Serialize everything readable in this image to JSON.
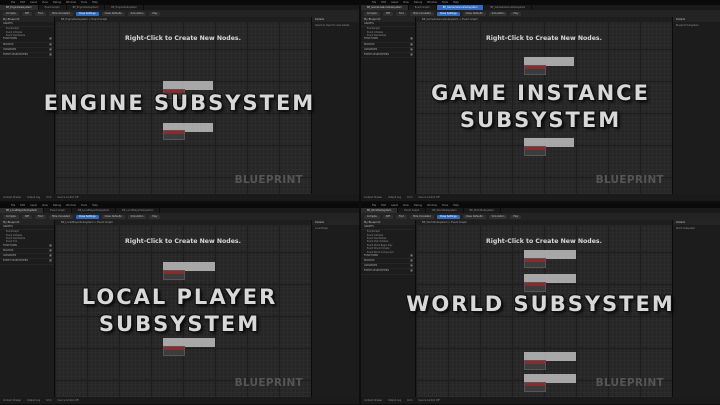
{
  "quadrants": [
    {
      "menu": [
        "File",
        "Edit",
        "Asset",
        "View",
        "Debug",
        "Window",
        "Tools",
        "Help"
      ],
      "tabs": [
        "BP_EngineSubsystem",
        "Event Graph",
        "BP_EngineSubsystem",
        "BP_EngineSubsystem"
      ],
      "toolbar": [
        "Compile",
        "Diff",
        "Find",
        "Hide Unrelated",
        "Class Settings",
        "Class Defaults",
        "Simulation",
        "Play"
      ],
      "left_header": "My Blueprint",
      "left_sections": [
        "GRAPHS",
        "FUNCTIONS",
        "MACROS",
        "VARIABLES",
        "EVENT DISPATCHERS"
      ],
      "left_items": [
        "EventGraph",
        "Event Initialize",
        "Event Deinitialize"
      ],
      "breadcrumb": "BP_EngineSubsystem > Event Graph",
      "graph_hint": "Right-Click to Create New Nodes.",
      "watermark": "BLUEPRINT",
      "right_header": "Details",
      "right_text": "Select an object to view details.",
      "status": [
        "Content Drawer",
        "Output Log",
        "Cmd",
        "Source Control Off"
      ],
      "overlay": [
        "ENGINE SUBSYSTEM"
      ]
    },
    {
      "menu": [
        "File",
        "Edit",
        "Asset",
        "View",
        "Debug",
        "Window",
        "Tools",
        "Help"
      ],
      "tabs": [
        "BP_GameInstanceSubsystem",
        "Event Graph",
        "BP_GameInstanceSubsystem",
        "BP_GameInstanceSubsystem"
      ],
      "toolbar": [
        "Compile",
        "Diff",
        "Find",
        "Hide Unrelated",
        "Class Settings",
        "Class Defaults",
        "Simulation",
        "Play"
      ],
      "left_header": "My Blueprint",
      "left_sections": [
        "GRAPHS",
        "FUNCTIONS",
        "MACROS",
        "VARIABLES",
        "EVENT DISPATCHERS"
      ],
      "left_items": [
        "EventGraph",
        "Event Initialize",
        "Event Deinitialize"
      ],
      "breadcrumb": "BP_GameInstanceSubsystem > Event Graph",
      "graph_hint": "Right-Click to Create New Nodes.",
      "watermark": "BLUEPRINT",
      "right_header": "Details",
      "right_text": "Blueprint Subsystem",
      "status": [
        "Content Drawer",
        "Output Log",
        "Cmd",
        "Source Control Off"
      ],
      "overlay": [
        "GAME INSTANCE",
        "SUBSYSTEM"
      ]
    },
    {
      "menu": [
        "File",
        "Edit",
        "Asset",
        "View",
        "Debug",
        "Window",
        "Tools",
        "Help"
      ],
      "tabs": [
        "BP_LocalPlayerSubsystem",
        "Event Graph",
        "BP_LocalPlayerSubsystem",
        "BP_LocalPlayerSubsystem"
      ],
      "toolbar": [
        "Compile",
        "Diff",
        "Find",
        "Hide Unrelated",
        "Class Settings",
        "Class Defaults",
        "Simulation",
        "Play"
      ],
      "left_header": "My Blueprint",
      "left_sections": [
        "GRAPHS",
        "FUNCTIONS",
        "MACROS",
        "VARIABLES",
        "EVENT DISPATCHERS"
      ],
      "left_items": [
        "EventGraph",
        "Event Initialize",
        "Event Deinitialize",
        "Event Tick"
      ],
      "breadcrumb": "BP_LocalPlayerSubsystem > Event Graph",
      "graph_hint": "Right-Click to Create New Nodes.",
      "watermark": "BLUEPRINT",
      "right_header": "Details",
      "right_text": "Local Player",
      "status": [
        "Content Drawer",
        "Output Log",
        "Cmd",
        "Source Control Off"
      ],
      "overlay": [
        "LOCAL PLAYER",
        "SUBSYSTEM"
      ]
    },
    {
      "menu": [
        "File",
        "Edit",
        "Asset",
        "View",
        "Debug",
        "Window",
        "Tools",
        "Help"
      ],
      "tabs": [
        "BP_WorldSubsystem",
        "Event Graph",
        "BP_WorldSubsystem",
        "BP_WorldSubsystem"
      ],
      "toolbar": [
        "Compile",
        "Diff",
        "Find",
        "Hide Unrelated",
        "Class Settings",
        "Class Defaults",
        "Simulation",
        "Play"
      ],
      "left_header": "My Blueprint",
      "left_sections": [
        "GRAPHS",
        "FUNCTIONS",
        "MACROS",
        "VARIABLES",
        "EVENT DISPATCHERS"
      ],
      "left_items": [
        "EventGraph",
        "Event Initialize",
        "Event Deinitialize",
        "Event Post Initialize",
        "Event World Begin Play",
        "Event Should Create",
        "Event World Component"
      ],
      "breadcrumb": "BP_WorldSubsystem > Event Graph",
      "graph_hint": "Right-Click to Create New Nodes.",
      "watermark": "BLUEPRINT",
      "right_header": "Details",
      "right_text": "World Subsystem",
      "status": [
        "Content Drawer",
        "Output Log",
        "Cmd",
        "Source Control Off"
      ],
      "overlay": [
        "WORLD SUBSYSTEM"
      ]
    }
  ],
  "colors": {
    "accent": "#2f6bbf",
    "node_header": "#8d2a2a",
    "graph_bg": "#262626",
    "overlay_text": "#d8d8d8"
  }
}
